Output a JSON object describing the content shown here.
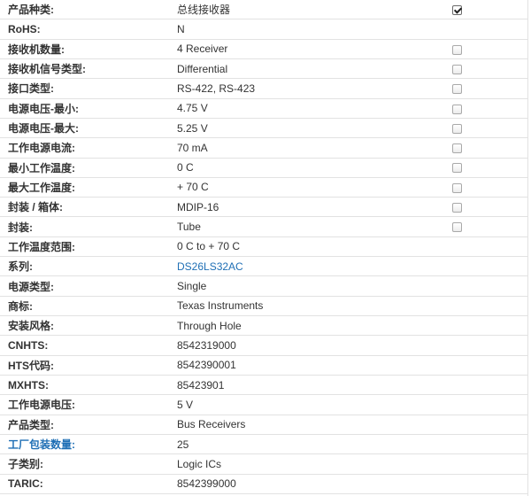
{
  "specs": [
    {
      "label": "产品种类:",
      "value": "总线接收器",
      "checkbox": "checked"
    },
    {
      "label": "RoHS:",
      "value": "N",
      "checkbox": "none"
    },
    {
      "label": "接收机数量:",
      "value": "4 Receiver",
      "checkbox": "unchecked"
    },
    {
      "label": "接收机信号类型:",
      "value": "Differential",
      "checkbox": "unchecked"
    },
    {
      "label": "接口类型:",
      "value": "RS-422, RS-423",
      "checkbox": "unchecked"
    },
    {
      "label": "电源电压-最小:",
      "value": "4.75 V",
      "checkbox": "unchecked"
    },
    {
      "label": "电源电压-最大:",
      "value": "5.25 V",
      "checkbox": "unchecked"
    },
    {
      "label": "工作电源电流:",
      "value": "70 mA",
      "checkbox": "unchecked"
    },
    {
      "label": "最小工作温度:",
      "value": "0 C",
      "checkbox": "unchecked"
    },
    {
      "label": "最大工作温度:",
      "value": "+ 70 C",
      "checkbox": "unchecked"
    },
    {
      "label": "封装 / 箱体:",
      "value": "MDIP-16",
      "checkbox": "unchecked"
    },
    {
      "label": "封装:",
      "value": "Tube",
      "checkbox": "unchecked"
    },
    {
      "label": "工作温度范围:",
      "value": "0 C to + 70 C",
      "checkbox": "none"
    },
    {
      "label": "系列:",
      "value": "DS26LS32AC",
      "checkbox": "none",
      "value_link": true
    },
    {
      "label": "电源类型:",
      "value": "Single",
      "checkbox": "none"
    },
    {
      "label": "商标:",
      "value": "Texas Instruments",
      "checkbox": "none"
    },
    {
      "label": "安装风格:",
      "value": "Through Hole",
      "checkbox": "none"
    },
    {
      "label": "CNHTS:",
      "value": "8542319000",
      "checkbox": "none"
    },
    {
      "label": "HTS代码:",
      "value": "8542390001",
      "checkbox": "none"
    },
    {
      "label": "MXHTS:",
      "value": "85423901",
      "checkbox": "none"
    },
    {
      "label": "工作电源电压:",
      "value": "5 V",
      "checkbox": "none"
    },
    {
      "label": "产品类型:",
      "value": "Bus Receivers",
      "checkbox": "none"
    },
    {
      "label": "工厂包装数量:",
      "value": "25",
      "checkbox": "none",
      "label_link": true
    },
    {
      "label": "子类别:",
      "value": "Logic ICs",
      "checkbox": "none"
    },
    {
      "label": "TARIC:",
      "value": "8542399000",
      "checkbox": "none"
    }
  ],
  "colors": {
    "text": "#333333",
    "link": "#1f6fb5",
    "border": "#e2e2e2"
  }
}
